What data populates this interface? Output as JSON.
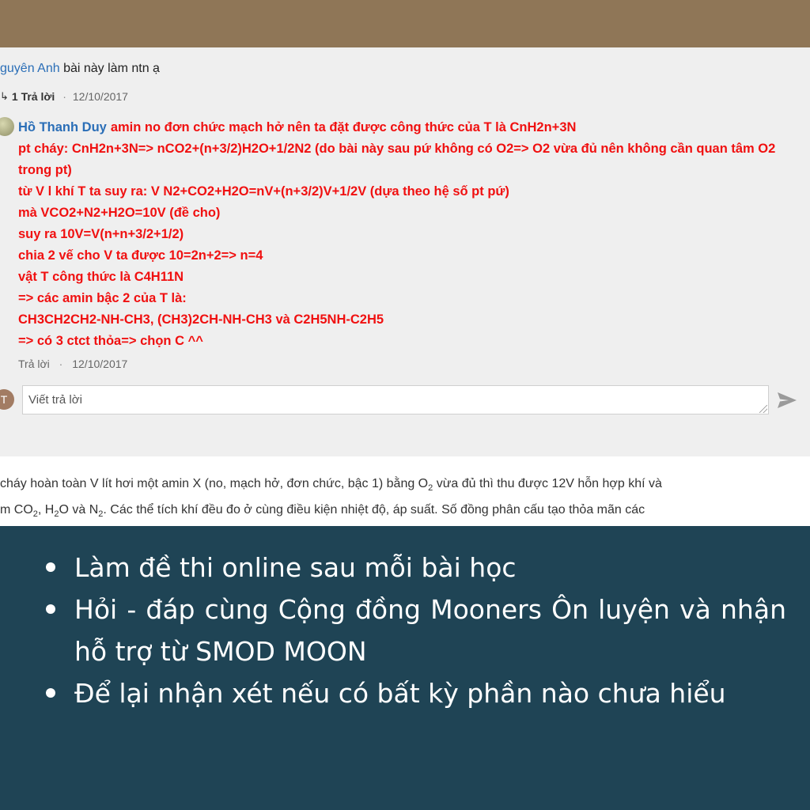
{
  "comment": {
    "author": "guyên Anh",
    "text": "bài này làm ntn ạ",
    "reply_icon": "reply-arrow-icon",
    "reply_count": "1 Trả lời",
    "dot": "·",
    "date": "12/10/2017"
  },
  "answer": {
    "author": "Hồ Thanh Duy",
    "lines": [
      "amin no đơn chức mạch hở nên ta đặt được công thức của T là CnH2n+3N",
      "pt cháy: CnH2n+3N=> nCO2+(n+3/2)H2O+1/2N2 (do bài này sau pứ không có O2=> O2 vừa đủ nên không cần quan tâm O2 trong pt)",
      "từ V l khí T ta suy ra: V N2+CO2+H2O=nV+(n+3/2)V+1/2V (dựa theo hệ số pt pứ)",
      "mà VCO2+N2+H2O=10V (đề cho)",
      "suy ra 10V=V(n+n+3/2+1/2)",
      "chia 2 vế cho V ta được 10=2n+2=> n=4",
      "vật T công thức là C4H11N",
      "=> các amin bậc 2 của T là:",
      "CH3CH2CH2-NH-CH3, (CH3)2CH-NH-CH3 và C2H5NH-C2H5",
      "=> có 3 ctct thỏa=> chọn C ^^"
    ],
    "reply_link": "Trả lời",
    "dot": "·",
    "date": "12/10/2017"
  },
  "reply_form": {
    "avatar_letter": "T",
    "placeholder": "Viết trả lời",
    "send_icon": "send-icon"
  },
  "question": {
    "line1_a": "cháy hoàn toàn V lít hơi một amin X (no, mạch hở, đơn chức, bậc 1) bằng O",
    "line1_sub": "2",
    "line1_b": " vừa đủ thì thu được 12V hỗn hợp khí và",
    "line2_a": "m CO",
    "line2_sub1": "2",
    "line2_b": ", H",
    "line2_sub2": "2",
    "line2_c": "O và N",
    "line2_sub3": "2",
    "line2_d": ". Các thể tích khí đều đo ở cùng điều kiện nhiệt độ, áp suất. Số đồng phân cấu tạo thỏa mãn các"
  },
  "features": [
    "Làm đề thi online sau mỗi bài học",
    "Hỏi - đáp cùng Cộng đồng Mooners Ôn luyện và nhận hỗ trợ từ SMOD MOON",
    "Để lại nhận xét nếu có bất kỳ phần nào chưa hiểu"
  ],
  "colors": {
    "frame": "#8f7657",
    "panel": "#1f4455",
    "answer_text": "#f01010",
    "author_link": "#2a6eb7"
  }
}
